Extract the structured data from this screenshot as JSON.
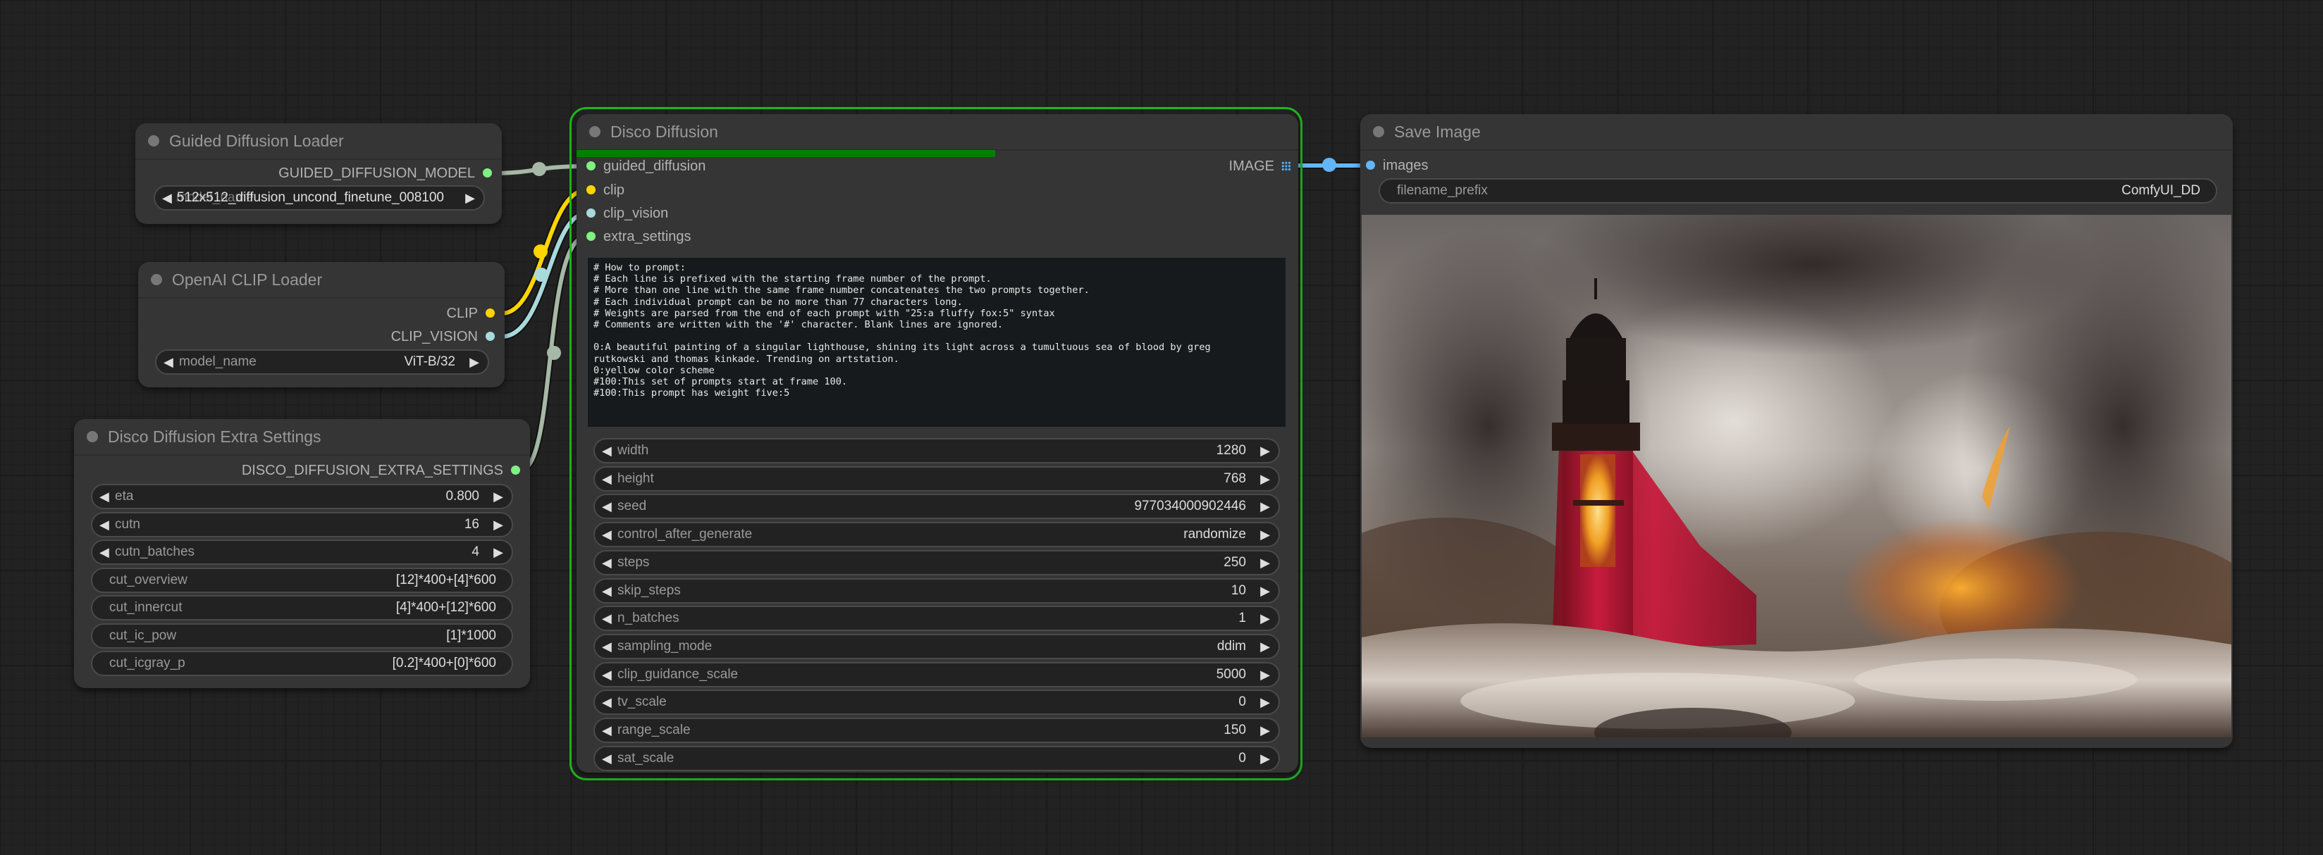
{
  "colors": {
    "model_link": "#a6b8a6",
    "clip_link": "#ffd500",
    "clip_vision_link": "#a8dadc",
    "extra_link": "#a6b8a6",
    "image_link": "#64b5f6",
    "pin_green": "#7ff27f",
    "pin_yellow": "#ffd500",
    "pin_cyan": "#a8dadc",
    "pin_blue": "#64b5f6",
    "running_outline": "#1fb51f",
    "progress": "#008000"
  },
  "nodes": {
    "guided_loader": {
      "title": "Guided Diffusion Loader",
      "output": "GUIDED_DIFFUSION_MODEL",
      "widget": {
        "label": "model_name",
        "value": "512x512_diffusion_uncond_finetune_008100"
      }
    },
    "clip_loader": {
      "title": "OpenAI CLIP Loader",
      "outputs": [
        "CLIP",
        "CLIP_VISION"
      ],
      "widget": {
        "label": "model_name",
        "value": "ViT-B/32"
      }
    },
    "extra_settings": {
      "title": "Disco Diffusion Extra Settings",
      "output": "DISCO_DIFFUSION_EXTRA_SETTINGS",
      "widgets": [
        {
          "label": "eta",
          "value": "0.800",
          "arrows": true
        },
        {
          "label": "cutn",
          "value": "16",
          "arrows": true
        },
        {
          "label": "cutn_batches",
          "value": "4",
          "arrows": true
        },
        {
          "label": "cut_overview",
          "value": "[12]*400+[4]*600",
          "arrows": false
        },
        {
          "label": "cut_innercut",
          "value": "[4]*400+[12]*600",
          "arrows": false
        },
        {
          "label": "cut_ic_pow",
          "value": "[1]*1000",
          "arrows": false
        },
        {
          "label": "cut_icgray_p",
          "value": "[0.2]*400+[0]*600",
          "arrows": false
        }
      ]
    },
    "disco": {
      "title": "Disco Diffusion",
      "progress": 0.58,
      "inputs": [
        "guided_diffusion",
        "clip",
        "clip_vision",
        "extra_settings"
      ],
      "output": "IMAGE",
      "prompt_text": "# How to prompt:\n# Each line is prefixed with the starting frame number of the prompt.\n# More than one line with the same frame number concatenates the two prompts together.\n# Each individual prompt can be no more than 77 characters long.\n# Weights are parsed from the end of each prompt with \"25:a fluffy fox:5\" syntax\n# Comments are written with the '#' character. Blank lines are ignored.\n\n0:A beautiful painting of a singular lighthouse, shining its light across a tumultuous sea of blood by greg\nrutkowski and thomas kinkade. Trending on artstation.\n0:yellow color scheme\n#100:This set of prompts start at frame 100.\n#100:This prompt has weight five:5",
      "widgets": [
        {
          "label": "width",
          "value": "1280"
        },
        {
          "label": "height",
          "value": "768"
        },
        {
          "label": "seed",
          "value": "977034000902446"
        },
        {
          "label": "control_after_generate",
          "value": "randomize"
        },
        {
          "label": "steps",
          "value": "250"
        },
        {
          "label": "skip_steps",
          "value": "10"
        },
        {
          "label": "n_batches",
          "value": "1"
        },
        {
          "label": "sampling_mode",
          "value": "ddim"
        },
        {
          "label": "clip_guidance_scale",
          "value": "5000"
        },
        {
          "label": "tv_scale",
          "value": "0"
        },
        {
          "label": "range_scale",
          "value": "150"
        },
        {
          "label": "sat_scale",
          "value": "0"
        }
      ]
    },
    "save": {
      "title": "Save Image",
      "input": "images",
      "widget": {
        "label": "filename_prefix",
        "value": "ComfyUI_DD"
      },
      "image_alt": "Painting of a red lighthouse in a stormy sea"
    }
  }
}
